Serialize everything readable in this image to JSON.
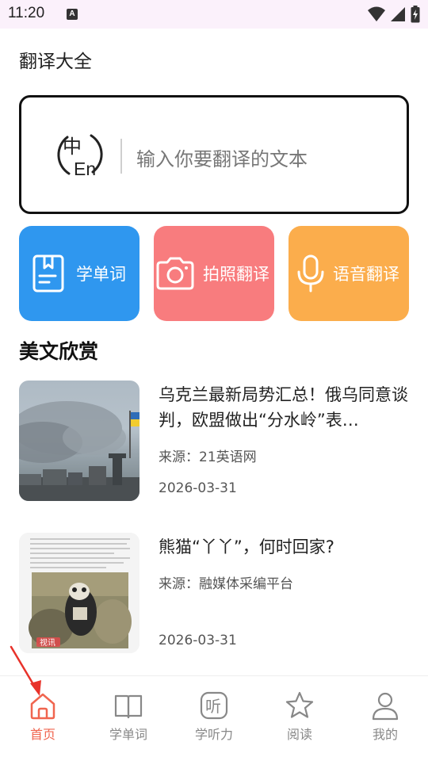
{
  "status_bar": {
    "time": "11:20",
    "notification_badge": "A"
  },
  "app": {
    "title": "翻译大全"
  },
  "translate_box": {
    "placeholder": "输入你要翻译的文本",
    "icon": "zh-en-translate-icon",
    "icon_text_zh": "中",
    "icon_text_en": "En"
  },
  "features": [
    {
      "label": "学单词",
      "icon": "notebook-icon",
      "color": "#2f97ef"
    },
    {
      "label": "拍照翻译",
      "icon": "camera-icon",
      "color": "#f87c7e"
    },
    {
      "label": "语音翻译",
      "icon": "microphone-icon",
      "color": "#fbad4c"
    }
  ],
  "section": {
    "title": "美文欣赏"
  },
  "articles": [
    {
      "title": "乌克兰最新局势汇总！俄乌同意谈判，欧盟做出“分水岭”表…",
      "source": "来源：21英语网",
      "date": "2026-03-31"
    },
    {
      "title": "熊猫“丫丫”，何时回家?",
      "source": "来源：融媒体采编平台",
      "date": "2026-03-31",
      "thumb_watermark": "视讯"
    }
  ],
  "tabs": [
    {
      "label": "首页",
      "icon": "home-icon",
      "active": true
    },
    {
      "label": "学单词",
      "icon": "book-icon",
      "active": false
    },
    {
      "label": "学听力",
      "icon": "listen-icon",
      "icon_text": "听",
      "active": false
    },
    {
      "label": "阅读",
      "icon": "star-icon",
      "active": false
    },
    {
      "label": "我的",
      "icon": "user-icon",
      "active": false
    }
  ],
  "colors": {
    "accent": "#f0654f",
    "inactive": "#888888",
    "status_bar_bg": "#fbf1fb"
  }
}
